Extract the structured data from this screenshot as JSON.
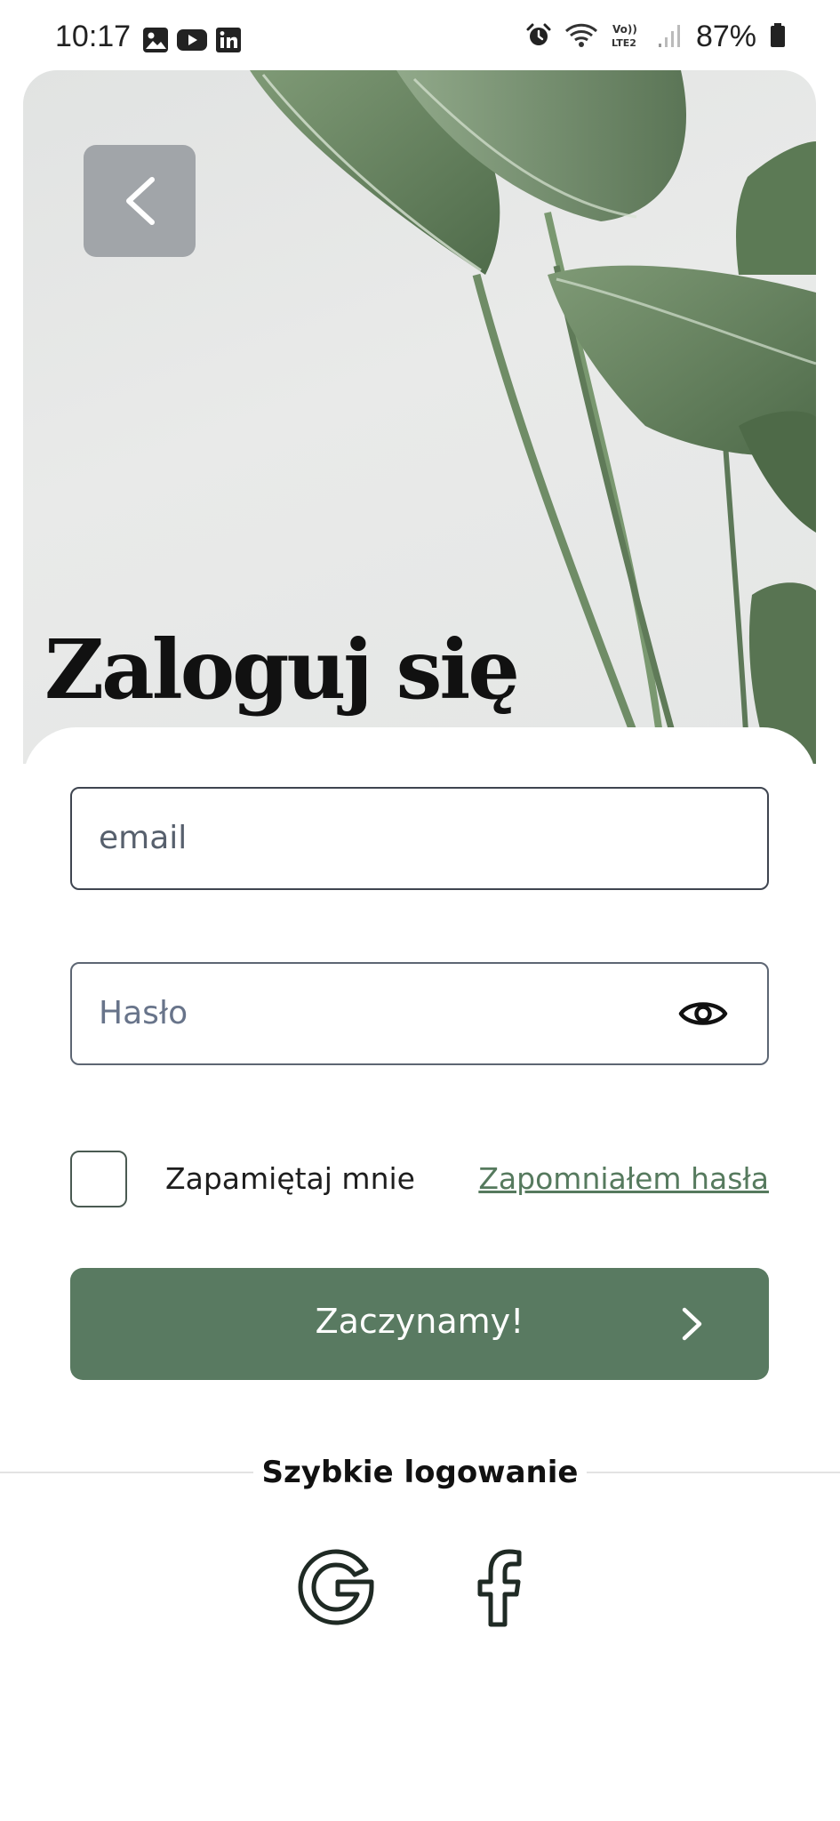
{
  "status_bar": {
    "time": "10:17",
    "battery": "87%",
    "icons_left": [
      "gallery-icon",
      "youtube-icon",
      "linkedin-icon"
    ],
    "icons_right": [
      "alarm-icon",
      "wifi-icon",
      "volte-icon",
      "signal-icon",
      "battery-icon"
    ]
  },
  "hero": {
    "title": "Zaloguj się"
  },
  "form": {
    "email_placeholder": "email",
    "password_placeholder": "Hasło",
    "remember_label": "Zapamiętaj mnie",
    "forgot_label": "Zapomniałem hasła",
    "submit_label": "Zaczynamy!"
  },
  "quick_login": {
    "label": "Szybkie logowanie",
    "providers": [
      "google-icon",
      "facebook-icon"
    ]
  },
  "colors": {
    "accent": "#597a61",
    "link": "#567a5e",
    "back_button": "#a1a5a9"
  }
}
